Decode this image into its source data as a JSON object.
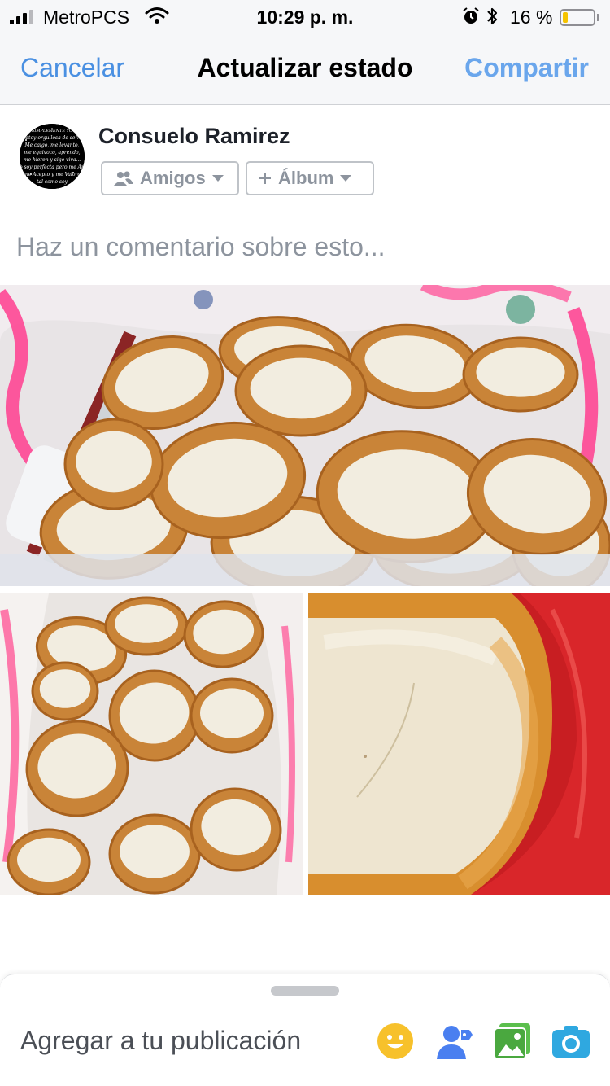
{
  "status_bar": {
    "carrier": "MetroPCS",
    "time": "10:29 p. m.",
    "battery_percent": "16 %",
    "battery_level": 0.16,
    "signal_bars": 3,
    "icons": [
      "signal-icon",
      "wifi-icon",
      "alarm-icon",
      "bluetooth-icon",
      "battery-icon"
    ]
  },
  "nav": {
    "cancel_label": "Cancelar",
    "title": "Actualizar estado",
    "share_label": "Compartir"
  },
  "author": {
    "name": "Consuelo Ramirez",
    "avatar_lines": [
      "SIMPLEMENTE YO",
      "Estoy orgullosa de ser...",
      "Me caigo, me levanto,",
      "me equivoco, aprendo,",
      "me hieren y sigo viva...",
      "No soy perfecta pero me Amo",
      "me Acepto y me Valoro",
      "tal como soy"
    ]
  },
  "audience": {
    "label": "Amigos",
    "icon": "friends-icon"
  },
  "album": {
    "label": "Álbum",
    "icon": "plus-icon"
  },
  "composer": {
    "placeholder": "Haz un comentario sobre esto..."
  },
  "photos": [
    {
      "name": "photo-main",
      "depicts": "basket of cheese-filled pastries"
    },
    {
      "name": "photo-left",
      "depicts": "stacked pastries in basket"
    },
    {
      "name": "photo-right",
      "depicts": "close-up pastry on red plate"
    }
  ],
  "add_to_post": {
    "label": "Agregar a tu publicación",
    "icons": [
      "feeling-emoji-icon",
      "tag-people-icon",
      "photo-icon",
      "camera-icon"
    ]
  },
  "colors": {
    "accent_blue": "#4a90e2",
    "bar_bg": "#f6f7f9",
    "battery_yellow": "#f5c300"
  }
}
